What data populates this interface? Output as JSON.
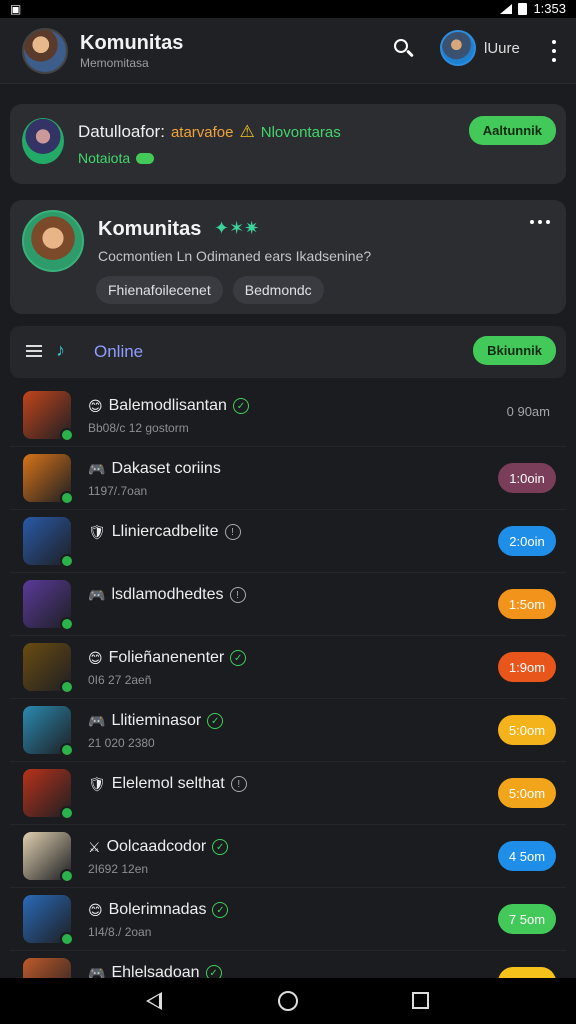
{
  "status": {
    "time": "1:353"
  },
  "header": {
    "title": "Komunitas",
    "subtitle": "Memomitasa",
    "user_name": "lUure"
  },
  "notice": {
    "label": "Datulloafor:",
    "highlight": "atarvafoe",
    "tag": "Nlovontaras",
    "status": "Notaiota",
    "button": "Aaltunnik"
  },
  "community": {
    "title": "Komunitas",
    "question": "Cocmontien Ln Odimaned ears Ikadsenine?",
    "chips": [
      "Fhienafoilecenet",
      "Bedmondc"
    ]
  },
  "online_bar": {
    "label": "Online",
    "button": "Bkiunnik"
  },
  "rows": [
    {
      "name": "Balemodlisantan",
      "sub": "Bb08/c 12 gostorm",
      "time": "0 90am",
      "pill": false,
      "pill_color": "",
      "thumb_color": "#c2451c",
      "glyph": "😊",
      "status": "green"
    },
    {
      "name": "Dakaset coriins",
      "sub": "1197/.7oan",
      "time": "1:0oin",
      "pill": true,
      "pill_color": "#7a3e5a",
      "thumb_color": "#d77418",
      "glyph": "🎮",
      "status": "none"
    },
    {
      "name": "Lliniercadbelite",
      "sub": "",
      "time": "2:0oin",
      "pill": true,
      "pill_color": "#1f8ee8",
      "thumb_color": "#2a5aa8",
      "glyph": "🛡",
      "status": "grey"
    },
    {
      "name": "lsdlamodhedtes",
      "sub": "",
      "time": "1:5om",
      "pill": true,
      "pill_color": "#f2931b",
      "thumb_color": "#5a3a9a",
      "glyph": "🎮",
      "status": "grey"
    },
    {
      "name": "Folieñanenenter",
      "sub": "0I6 27 2aeñ",
      "time": "1:9om",
      "pill": true,
      "pill_color": "#e8561c",
      "thumb_color": "#6b4c10",
      "glyph": "😊",
      "status": "green"
    },
    {
      "name": "Llitieminasor",
      "sub": "21 020 2380",
      "time": "5:0om",
      "pill": true,
      "pill_color": "#f4b31b",
      "thumb_color": "#2a8ab0",
      "glyph": "🎮",
      "status": "green"
    },
    {
      "name": "Elelemol selthat",
      "sub": "",
      "time": "5:0om",
      "pill": true,
      "pill_color": "#f2a51b",
      "thumb_color": "#b8321a",
      "glyph": "🛡",
      "status": "grey"
    },
    {
      "name": "Oolcaadcodor",
      "sub": "2I692 12en",
      "time": "4 5om",
      "pill": true,
      "pill_color": "#1f8ee8",
      "thumb_color": "#e0d0b0",
      "glyph": "⚔",
      "status": "leaf"
    },
    {
      "name": "Bolerimnadas",
      "sub": "1I4/8./ 2oan",
      "time": "7 5om",
      "pill": true,
      "pill_color": "#43c95a",
      "thumb_color": "#2a6ab8",
      "glyph": "😊",
      "status": "green"
    },
    {
      "name": "Ehlelsadoan",
      "sub": "",
      "time": "",
      "pill": true,
      "pill_color": "#f4c21b",
      "thumb_color": "#c05a2a",
      "glyph": "🎮",
      "status": "leaf"
    }
  ]
}
